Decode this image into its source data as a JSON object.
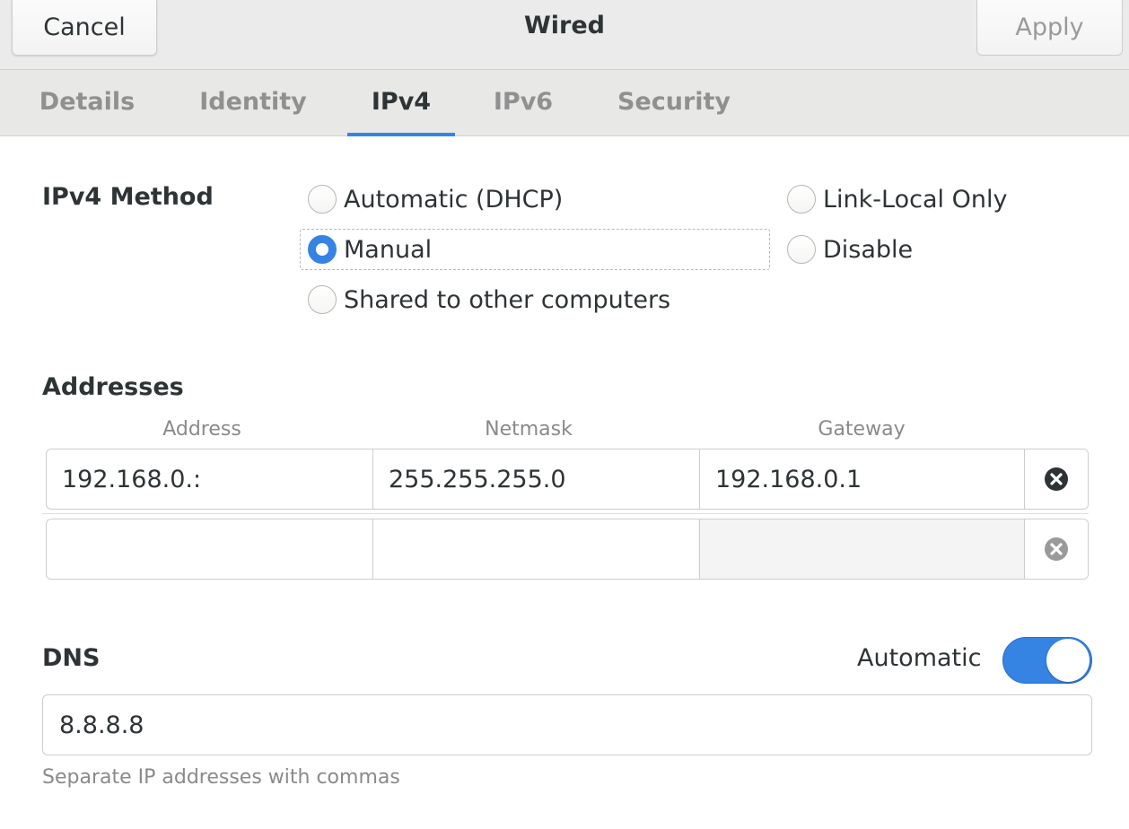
{
  "header": {
    "title": "Wired",
    "cancel_label": "Cancel",
    "apply_label": "Apply"
  },
  "tabs": [
    {
      "label": "Details",
      "active": false
    },
    {
      "label": "Identity",
      "active": false
    },
    {
      "label": "IPv4",
      "active": true
    },
    {
      "label": "IPv6",
      "active": false
    },
    {
      "label": "Security",
      "active": false
    }
  ],
  "ipv4_method": {
    "label": "IPv4 Method",
    "options": [
      {
        "label": "Automatic (DHCP)",
        "checked": false
      },
      {
        "label": "Manual",
        "checked": true
      },
      {
        "label": "Shared to other computers",
        "checked": false
      },
      {
        "label": "Link-Local Only",
        "checked": false
      },
      {
        "label": "Disable",
        "checked": false
      }
    ]
  },
  "addresses": {
    "label": "Addresses",
    "columns": [
      "Address",
      "Netmask",
      "Gateway"
    ],
    "rows": [
      {
        "address": "192.168.0.:",
        "netmask": "255.255.255.0",
        "gateway": "192.168.0.1"
      },
      {
        "address": "",
        "netmask": "",
        "gateway": ""
      }
    ],
    "delete_icon": "close-circle-icon"
  },
  "dns": {
    "label": "DNS",
    "automatic_label": "Automatic",
    "automatic_on": true,
    "value": "8.8.8.8",
    "hint": "Separate IP addresses with commas"
  },
  "colors": {
    "accent": "#3584e4",
    "text": "#2e3436",
    "dim_text": "#909090"
  }
}
